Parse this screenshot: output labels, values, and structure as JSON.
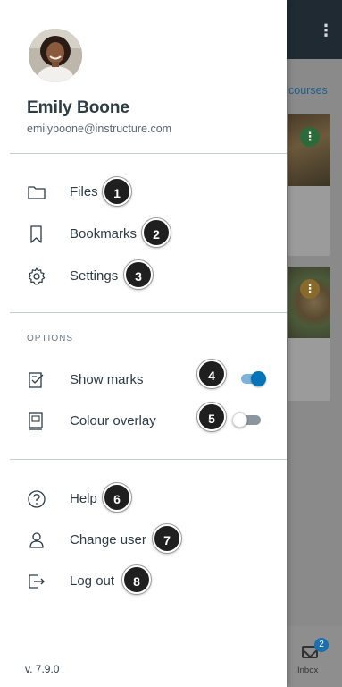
{
  "profile": {
    "name": "Emily Boone",
    "email": "emilyboone@instructure.com"
  },
  "menu": {
    "files": "Files",
    "bookmarks": "Bookmarks",
    "settings": "Settings"
  },
  "options": {
    "heading": "OPTIONS",
    "show_marks": "Show marks",
    "show_marks_on": true,
    "colour_overlay": "Colour overlay",
    "colour_overlay_on": false
  },
  "account": {
    "help": "Help",
    "change_user": "Change user",
    "log_out": "Log out"
  },
  "callouts": [
    "1",
    "2",
    "3",
    "4",
    "5",
    "6",
    "7",
    "8"
  ],
  "version": "v. 7.9.0",
  "background": {
    "courses_link": "courses",
    "inbox_label": "Inbox",
    "inbox_badge": "2",
    "kebab": "⋮"
  },
  "colors": {
    "text": "#2d3b45",
    "toggle_on_knob": "#0374b5",
    "toggle_on_track": "#7db3db",
    "toggle_off_track": "#8b969e",
    "callout_bg": "#1f1f1f"
  },
  "icons": {
    "files": "folder-icon",
    "bookmarks": "bookmark-icon",
    "settings": "gear-icon",
    "show_marks": "marks-icon",
    "colour_overlay": "overlay-icon",
    "help": "help-icon",
    "change_user": "user-icon",
    "log_out": "logout-icon"
  }
}
